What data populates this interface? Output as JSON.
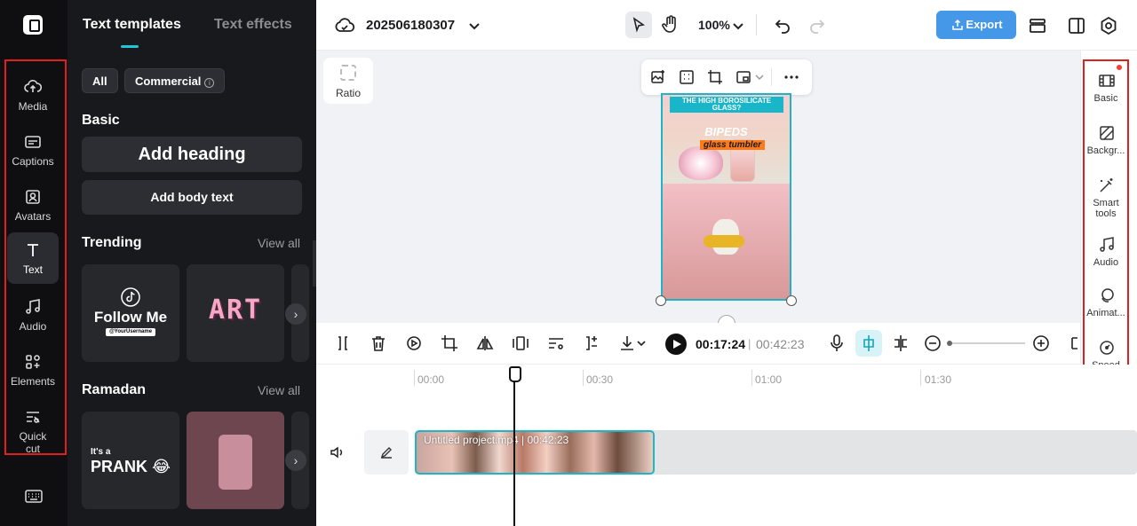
{
  "rail": {
    "items": [
      {
        "label": "Media"
      },
      {
        "label": "Captions"
      },
      {
        "label": "Avatars"
      },
      {
        "label": "Text"
      },
      {
        "label": "Audio"
      },
      {
        "label": "Elements"
      },
      {
        "label": "Quick cut"
      }
    ],
    "active": "Text"
  },
  "panel": {
    "tabs": [
      "Text templates",
      "Text effects"
    ],
    "filters": {
      "all": "All",
      "commercial": "Commercial"
    },
    "basic": {
      "title": "Basic",
      "add_heading": "Add heading",
      "add_body": "Add body text"
    },
    "trending": {
      "title": "Trending",
      "view_all": "View all",
      "tile1_title": "Follow Me",
      "tile1_handle": "@YourUsername",
      "tile2_text": "ART"
    },
    "ramadan": {
      "title": "Ramadan",
      "view_all": "View all",
      "tile1_small": "It's a",
      "tile1_big": "PRANK 😂"
    }
  },
  "topbar": {
    "project_name": "202506180307",
    "zoom": "100%",
    "export_label": "Export"
  },
  "canvas": {
    "ratio_label": "Ratio",
    "video": {
      "headline": "THE HIGH BOROSILICATE GLASS?",
      "brand": "BIPEDS",
      "subtitle": "glass tumbler"
    }
  },
  "properties": {
    "items": [
      {
        "label": "Basic"
      },
      {
        "label": "Backgr..."
      },
      {
        "label": "Smart tools"
      },
      {
        "label": "Audio"
      },
      {
        "label": "Animat..."
      },
      {
        "label": "Speed"
      }
    ]
  },
  "timeline": {
    "current_time": "00:17:24",
    "separator": "|",
    "total_time": "00:42:23",
    "ruler": [
      "00:00",
      "00:30",
      "01:00",
      "01:30"
    ],
    "clip_label": "Untitled project.mp4 | 00:42:23"
  },
  "colors": {
    "accent": "#21c6d6",
    "export_blue": "#4597e8",
    "highlight_red": "#e02020",
    "rail_bg": "#0f0f11",
    "panel_bg": "#18191c"
  }
}
